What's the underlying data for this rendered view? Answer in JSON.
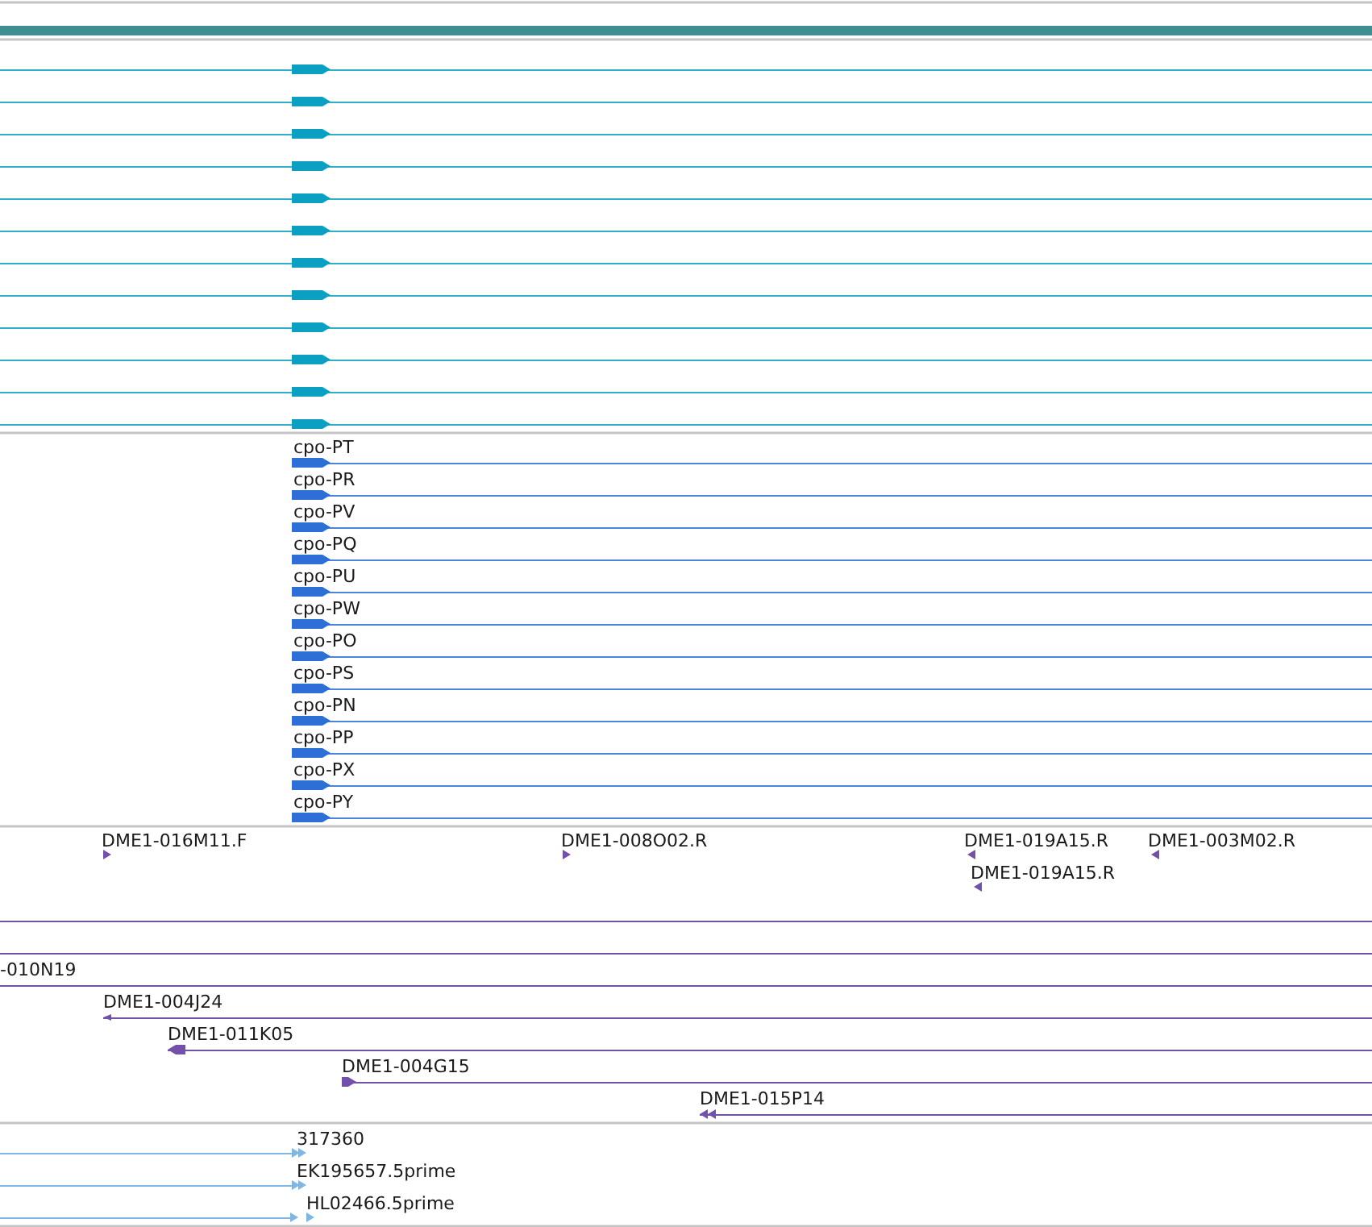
{
  "top_band": {
    "color": "#3f8f92"
  },
  "tracks": [
    {
      "kind": "transcripts",
      "color": "#0ba0c2",
      "features": [
        {
          "reverse": false
        },
        {
          "reverse": false
        },
        {
          "reverse": false
        },
        {
          "reverse": false
        },
        {
          "reverse": false
        },
        {
          "reverse": false
        },
        {
          "reverse": false
        },
        {
          "reverse": false
        },
        {
          "reverse": false
        },
        {
          "reverse": false
        },
        {
          "reverse": false
        },
        {
          "reverse": false
        }
      ]
    },
    {
      "kind": "labeled_transcripts",
      "color": "#2d6fd6",
      "features": [
        {
          "label": "cpo-PT",
          "reverse": false
        },
        {
          "label": "cpo-PR",
          "reverse": false
        },
        {
          "label": "cpo-PV",
          "reverse": false
        },
        {
          "label": "cpo-PQ",
          "reverse": false
        },
        {
          "label": "cpo-PU",
          "reverse": false
        },
        {
          "label": "cpo-PW",
          "reverse": false
        },
        {
          "label": "cpo-PO",
          "reverse": false
        },
        {
          "label": "cpo-PS",
          "reverse": false
        },
        {
          "label": "cpo-PN",
          "reverse": false
        },
        {
          "label": "cpo-PP",
          "reverse": false
        },
        {
          "label": "cpo-PX",
          "reverse": false
        },
        {
          "label": "cpo-PY",
          "reverse": false
        }
      ]
    },
    {
      "kind": "end_reads",
      "color": "#7350aa",
      "features": [
        {
          "label": "DME1-016M11.F",
          "reverse": false
        },
        {
          "label": "DME1-008O02.R",
          "reverse": false
        },
        {
          "label": "DME1-019A15.R",
          "reverse": true
        },
        {
          "label": "DME1-003M02.R",
          "reverse": true
        },
        {
          "label": "DME1-019A15.R",
          "reverse": true
        }
      ]
    },
    {
      "kind": "clones",
      "color": "#7350aa",
      "features": [
        {
          "arrow": false
        },
        {
          "arrow": false
        },
        {
          "label": "-010N19",
          "arrow": false
        },
        {
          "label": "DME1-004J24",
          "arrow": true,
          "reverse": true
        },
        {
          "label": "DME1-011K05",
          "arrow": true,
          "reverse": true
        },
        {
          "label": "DME1-004G15",
          "arrow": true,
          "reverse": false
        },
        {
          "label": "DME1-015P14",
          "arrow": true,
          "reverse": true
        }
      ]
    },
    {
      "kind": "ests",
      "color": "#7fb6e2",
      "features": [
        {
          "label": "317360",
          "reverse": false
        },
        {
          "label": "EK195657.5prime",
          "reverse": false
        },
        {
          "label": "HL02466.5prime",
          "reverse": false
        }
      ]
    }
  ]
}
